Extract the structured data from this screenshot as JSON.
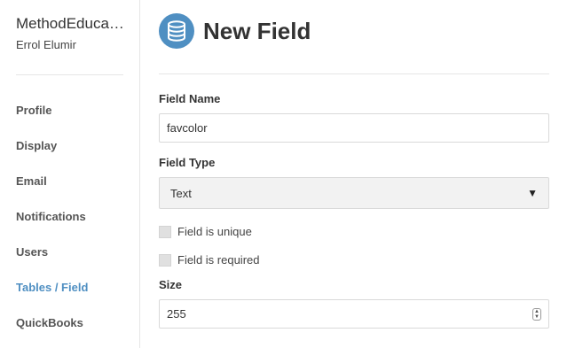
{
  "sidebar": {
    "org_name": "MethodEducation",
    "user_name": "Errol Elumir",
    "items": [
      {
        "label": "Profile"
      },
      {
        "label": "Display"
      },
      {
        "label": "Email"
      },
      {
        "label": "Notifications"
      },
      {
        "label": "Users"
      },
      {
        "label": "Tables / Field",
        "active": true
      },
      {
        "label": "QuickBooks"
      }
    ],
    "active_color": "#4f8fc2"
  },
  "header": {
    "title": "New Field",
    "icon": "database-icon",
    "icon_color": "#4f8fc2"
  },
  "form": {
    "field_name": {
      "label": "Field Name",
      "value": "favcolor"
    },
    "field_type": {
      "label": "Field Type",
      "value": "Text"
    },
    "unique": {
      "label": "Field is unique",
      "checked": false
    },
    "required": {
      "label": "Field is required",
      "checked": false
    },
    "size": {
      "label": "Size",
      "value": "255"
    }
  }
}
